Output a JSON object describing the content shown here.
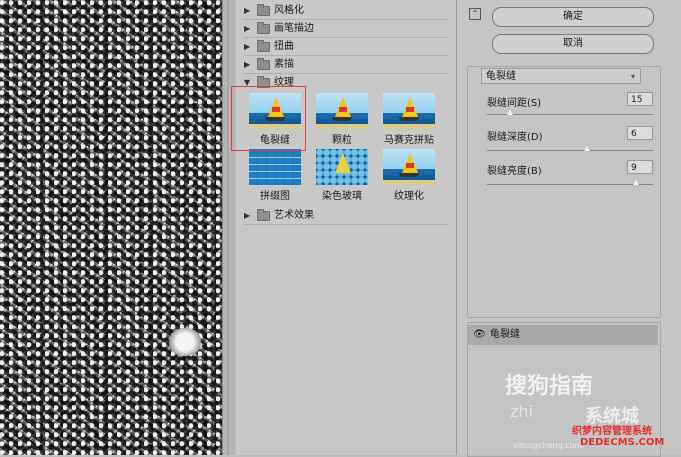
{
  "categories": [
    {
      "label": "风格化",
      "expanded": false
    },
    {
      "label": "画笔描边",
      "expanded": false
    },
    {
      "label": "扭曲",
      "expanded": false
    },
    {
      "label": "素描",
      "expanded": false
    },
    {
      "label": "纹理",
      "expanded": true
    },
    {
      "label": "艺术效果",
      "expanded": false
    }
  ],
  "texture_filters": [
    {
      "label": "龟裂缝",
      "selected": true
    },
    {
      "label": "颗粒",
      "selected": false
    },
    {
      "label": "马赛克拼贴",
      "selected": false
    },
    {
      "label": "拼缀图",
      "selected": false
    },
    {
      "label": "染色玻璃",
      "selected": false
    },
    {
      "label": "纹理化",
      "selected": false
    }
  ],
  "buttons": {
    "ok": "确定",
    "cancel": "取消"
  },
  "filter_select": {
    "value": "龟裂缝"
  },
  "params": [
    {
      "label": "裂缝间距(S)",
      "value": "15",
      "fraction": 0.14
    },
    {
      "label": "裂缝深度(D)",
      "value": "6",
      "fraction": 0.6
    },
    {
      "label": "裂缝亮度(B)",
      "value": "9",
      "fraction": 0.9
    }
  ],
  "layer": {
    "name": "龟裂缝"
  },
  "watermarks": {
    "sogou": "搜狗指南",
    "zhi": "zhi",
    "site": "系统城",
    "site_url": "xitongcheng.com",
    "dede1": "织梦内容管理系统",
    "dede2": "DEDECMS.COM"
  },
  "colors": {
    "selection_border": "#d9453a",
    "layer_row": "#a9a9a9"
  },
  "icons": {
    "expand": "triangle-right-icon",
    "collapse": "triangle-down-icon",
    "folder": "folder-icon",
    "eye": "eye-icon",
    "toggle": "collapse-toggle-icon"
  }
}
